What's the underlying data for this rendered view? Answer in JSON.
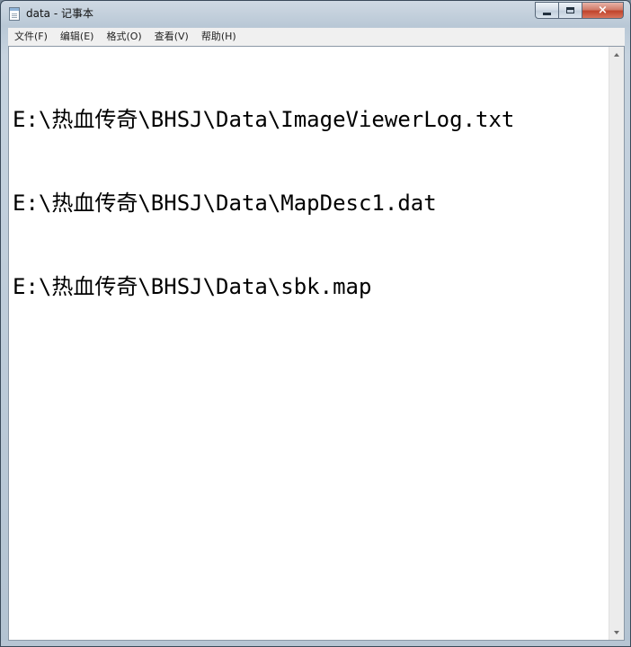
{
  "window": {
    "title": "data - 记事本",
    "controls": {
      "minimize_glyph": "minimize-icon",
      "maximize_glyph": "maximize-icon",
      "close_glyph": "×"
    }
  },
  "menu": {
    "items": [
      {
        "label": "文件(F)"
      },
      {
        "label": "编辑(E)"
      },
      {
        "label": "格式(O)"
      },
      {
        "label": "查看(V)"
      },
      {
        "label": "帮助(H)"
      }
    ]
  },
  "document": {
    "lines": [
      "E:\\热血传奇\\BHSJ\\Data\\ImageViewerLog.txt",
      "E:\\热血传奇\\BHSJ\\Data\\MapDesc1.dat",
      "E:\\热血传奇\\BHSJ\\Data\\sbk.map"
    ]
  },
  "colors": {
    "title_bar": "#c3d0dd",
    "menu_bar": "#f0f0f0",
    "editor_bg": "#ffffff",
    "close_button": "#c0442c"
  }
}
